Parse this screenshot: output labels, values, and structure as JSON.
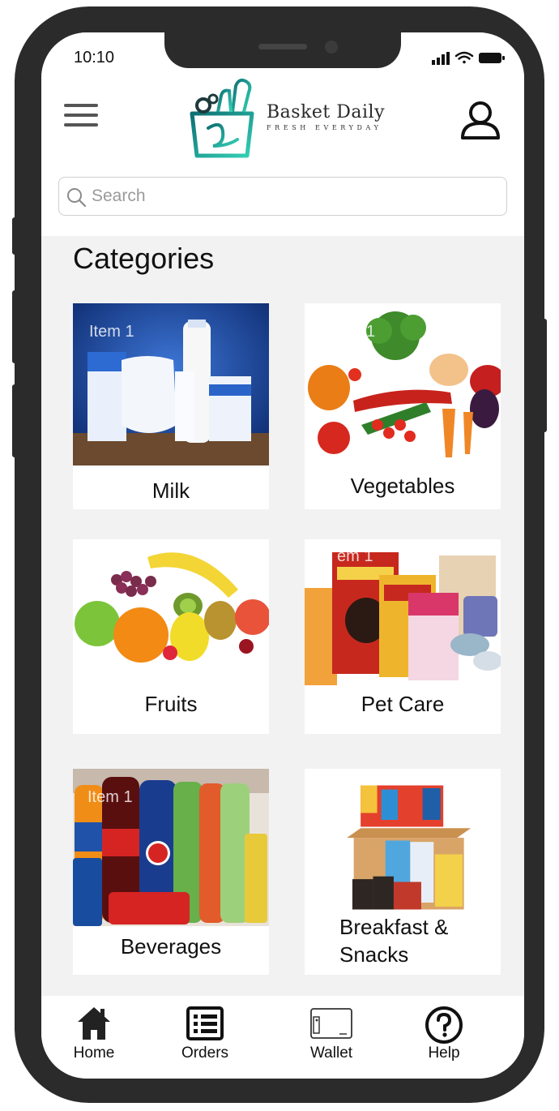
{
  "status_bar": {
    "time": "10:10"
  },
  "header": {
    "brand_name": "Basket Daily",
    "brand_tagline": "FRESH EVERYDAY"
  },
  "search": {
    "placeholder": "Search"
  },
  "section_title": "Categories",
  "categories": [
    {
      "label": "Milk",
      "overlay": "Item 1"
    },
    {
      "label": "Vegetables",
      "overlay": "1"
    },
    {
      "label": "Fruits",
      "overlay": ""
    },
    {
      "label": "Pet Care",
      "overlay": "em 1"
    },
    {
      "label": "Beverages",
      "overlay": "Item 1"
    },
    {
      "label": "Breakfast &\nSnacks",
      "overlay": ""
    }
  ],
  "bottom_nav": [
    {
      "label": "Home",
      "icon": "home-icon"
    },
    {
      "label": "Orders",
      "icon": "orders-list-icon"
    },
    {
      "label": "Wallet",
      "icon": "wallet-icon"
    },
    {
      "label": "Help",
      "icon": "help-icon"
    }
  ],
  "colors": {
    "phone_frame": "#2b2b2b",
    "screen_bg": "#f2f2f2",
    "card_bg": "#ffffff",
    "logo_teal": "#1fb8a6"
  }
}
